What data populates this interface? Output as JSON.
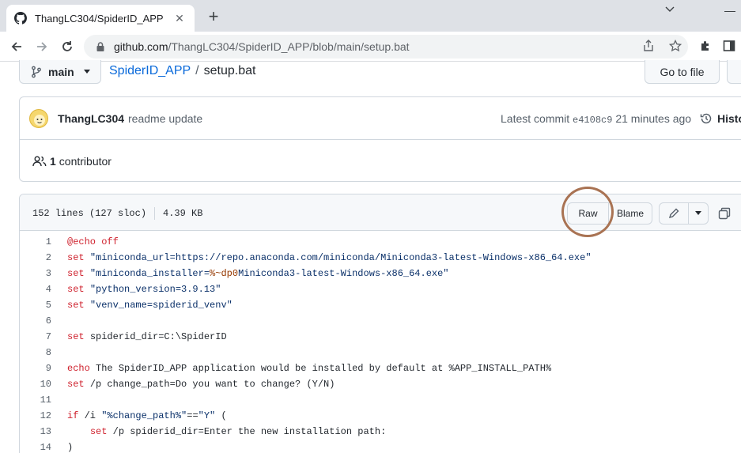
{
  "browser": {
    "tab_title": "ThangLC304/SpiderID_APP",
    "url_host": "github.com",
    "url_path": "/ThangLC304/SpiderID_APP/blob/main/setup.bat"
  },
  "repo_nav": {
    "branch": "main",
    "repo_name": "SpiderID_APP",
    "separator": "/",
    "file_name": "setup.bat",
    "go_to_file": "Go to file"
  },
  "commit": {
    "author": "ThangLC304",
    "message": "readme update",
    "latest_label": "Latest commit",
    "sha": "e4108c9",
    "time": "21 minutes ago",
    "history_label": "Histo"
  },
  "contributors": {
    "count": "1",
    "label": "contributor"
  },
  "file": {
    "lines_info": "152 lines (127 sloc)",
    "size": "4.39 KB",
    "raw_label": "Raw",
    "blame_label": "Blame"
  },
  "code_lines": [
    {
      "n": "1",
      "segs": [
        {
          "t": "@echo off",
          "c": "kw"
        }
      ]
    },
    {
      "n": "2",
      "segs": [
        {
          "t": "set ",
          "c": "kw"
        },
        {
          "t": "\"miniconda_url=https://repo.anaconda.com/miniconda/Miniconda3-latest-Windows-x86_64.exe\"",
          "c": "str"
        }
      ]
    },
    {
      "n": "3",
      "segs": [
        {
          "t": "set ",
          "c": "kw"
        },
        {
          "t": "\"miniconda_installer=",
          "c": "str"
        },
        {
          "t": "%~dp0",
          "c": "var"
        },
        {
          "t": "Miniconda3-latest-Windows-x86_64.exe\"",
          "c": "str"
        }
      ]
    },
    {
      "n": "4",
      "segs": [
        {
          "t": "set ",
          "c": "kw"
        },
        {
          "t": "\"python_version=3.9.13\"",
          "c": "str"
        }
      ]
    },
    {
      "n": "5",
      "segs": [
        {
          "t": "set ",
          "c": "kw"
        },
        {
          "t": "\"venv_name=spiderid_venv\"",
          "c": "str"
        }
      ]
    },
    {
      "n": "6",
      "segs": []
    },
    {
      "n": "7",
      "segs": [
        {
          "t": "set ",
          "c": "kw"
        },
        {
          "t": "spiderid_dir=C:\\SpiderID",
          "c": ""
        }
      ]
    },
    {
      "n": "8",
      "segs": []
    },
    {
      "n": "9",
      "segs": [
        {
          "t": "echo ",
          "c": "kw"
        },
        {
          "t": "The SpiderID_APP application would be installed by default at %APP_INSTALL_PATH%",
          "c": ""
        }
      ]
    },
    {
      "n": "10",
      "segs": [
        {
          "t": "set ",
          "c": "kw"
        },
        {
          "t": "/p change_path=Do you want to change? (Y/N)",
          "c": ""
        }
      ]
    },
    {
      "n": "11",
      "segs": []
    },
    {
      "n": "12",
      "segs": [
        {
          "t": "if ",
          "c": "kw"
        },
        {
          "t": "/i ",
          "c": ""
        },
        {
          "t": "\"%change_path%\"",
          "c": "str"
        },
        {
          "t": "==",
          "c": ""
        },
        {
          "t": "\"Y\"",
          "c": "str"
        },
        {
          "t": " (",
          "c": ""
        }
      ]
    },
    {
      "n": "13",
      "segs": [
        {
          "t": "    ",
          "c": ""
        },
        {
          "t": "set ",
          "c": "kw"
        },
        {
          "t": "/p spiderid_dir=Enter the new installation path:",
          "c": ""
        }
      ]
    },
    {
      "n": "14",
      "segs": [
        {
          "t": ")",
          "c": ""
        }
      ]
    }
  ]
}
